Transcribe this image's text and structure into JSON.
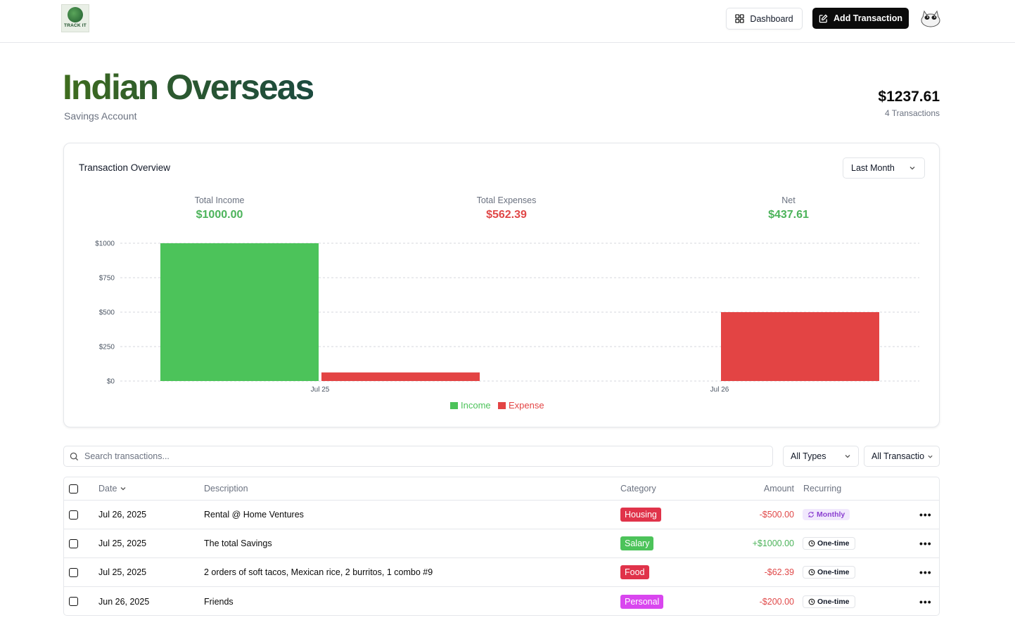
{
  "header": {
    "logo_text": "TRACK IT",
    "dashboard_label": "Dashboard",
    "add_label": "Add Transaction"
  },
  "account": {
    "name": "Indian Overseas",
    "type": "Savings Account",
    "balance": "$1237.61",
    "tx_count": "4 Transactions"
  },
  "overview": {
    "title": "Transaction Overview",
    "period": "Last Month",
    "income_label": "Total Income",
    "income_value": "$1000.00",
    "expense_label": "Total Expenses",
    "expense_value": "$562.39",
    "net_label": "Net",
    "net_value": "$437.61"
  },
  "chart_data": {
    "type": "bar",
    "categories": [
      "Jul 25",
      "Jul 26"
    ],
    "series": [
      {
        "name": "Income",
        "values": [
          1000,
          0
        ],
        "color": "#4cc35a"
      },
      {
        "name": "Expense",
        "values": [
          62.39,
          500
        ],
        "color": "#e34444"
      }
    ],
    "y_ticks": [
      "$0",
      "$250",
      "$500",
      "$750",
      "$1000"
    ],
    "ylim": [
      0,
      1000
    ],
    "grid": "dashed-horizontal",
    "legend": "bottom-center"
  },
  "filters": {
    "search_placeholder": "Search transactions...",
    "type_filter": "All Types",
    "tx_filter": "All Transactio"
  },
  "table": {
    "headers": {
      "date": "Date",
      "description": "Description",
      "category": "Category",
      "amount": "Amount",
      "recurring": "Recurring"
    },
    "rows": [
      {
        "date": "Jul 26, 2025",
        "description": "Rental @ Home Ventures",
        "category": "Housing",
        "category_color": "#e0334a",
        "amount": "-$500.00",
        "amount_type": "expense",
        "recurring": "Monthly",
        "recurring_kind": "monthly"
      },
      {
        "date": "Jul 25, 2025",
        "description": "The total Savings",
        "category": "Salary",
        "category_color": "#4cc35a",
        "amount": "+$1000.00",
        "amount_type": "income",
        "recurring": "One-time",
        "recurring_kind": "once"
      },
      {
        "date": "Jul 25, 2025",
        "description": "2 orders of soft tacos, Mexican rice, 2 burritos, 1 combo #9",
        "category": "Food",
        "category_color": "#e0334a",
        "amount": "-$62.39",
        "amount_type": "expense",
        "recurring": "One-time",
        "recurring_kind": "once"
      },
      {
        "date": "Jun 26, 2025",
        "description": "Friends",
        "category": "Personal",
        "category_color": "#d946ef",
        "amount": "-$200.00",
        "amount_type": "expense",
        "recurring": "One-time",
        "recurring_kind": "once"
      }
    ]
  }
}
